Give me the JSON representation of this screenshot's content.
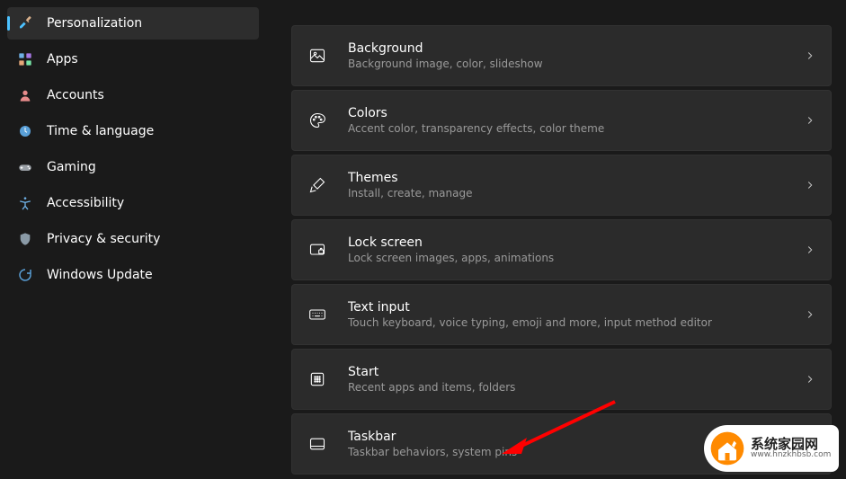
{
  "sidebar": {
    "items": [
      {
        "id": "personalization",
        "label": "Personalization",
        "selected": true
      },
      {
        "id": "apps",
        "label": "Apps",
        "selected": false
      },
      {
        "id": "accounts",
        "label": "Accounts",
        "selected": false
      },
      {
        "id": "time-language",
        "label": "Time & language",
        "selected": false
      },
      {
        "id": "gaming",
        "label": "Gaming",
        "selected": false
      },
      {
        "id": "accessibility",
        "label": "Accessibility",
        "selected": false
      },
      {
        "id": "privacy",
        "label": "Privacy & security",
        "selected": false
      },
      {
        "id": "update",
        "label": "Windows Update",
        "selected": false
      }
    ]
  },
  "main": {
    "cards": [
      {
        "id": "background",
        "title": "Background",
        "subtitle": "Background image, color, slideshow"
      },
      {
        "id": "colors",
        "title": "Colors",
        "subtitle": "Accent color, transparency effects, color theme"
      },
      {
        "id": "themes",
        "title": "Themes",
        "subtitle": "Install, create, manage"
      },
      {
        "id": "lock-screen",
        "title": "Lock screen",
        "subtitle": "Lock screen images, apps, animations"
      },
      {
        "id": "text-input",
        "title": "Text input",
        "subtitle": "Touch keyboard, voice typing, emoji and more, input method editor"
      },
      {
        "id": "start",
        "title": "Start",
        "subtitle": "Recent apps and items, folders"
      },
      {
        "id": "taskbar",
        "title": "Taskbar",
        "subtitle": "Taskbar behaviors, system pins"
      }
    ]
  },
  "watermark": {
    "cn": "系统家园网",
    "url": "www.hnzkhbsb.com"
  },
  "colors": {
    "accent": "#4cc2ff",
    "arrow": "#ff0000"
  }
}
